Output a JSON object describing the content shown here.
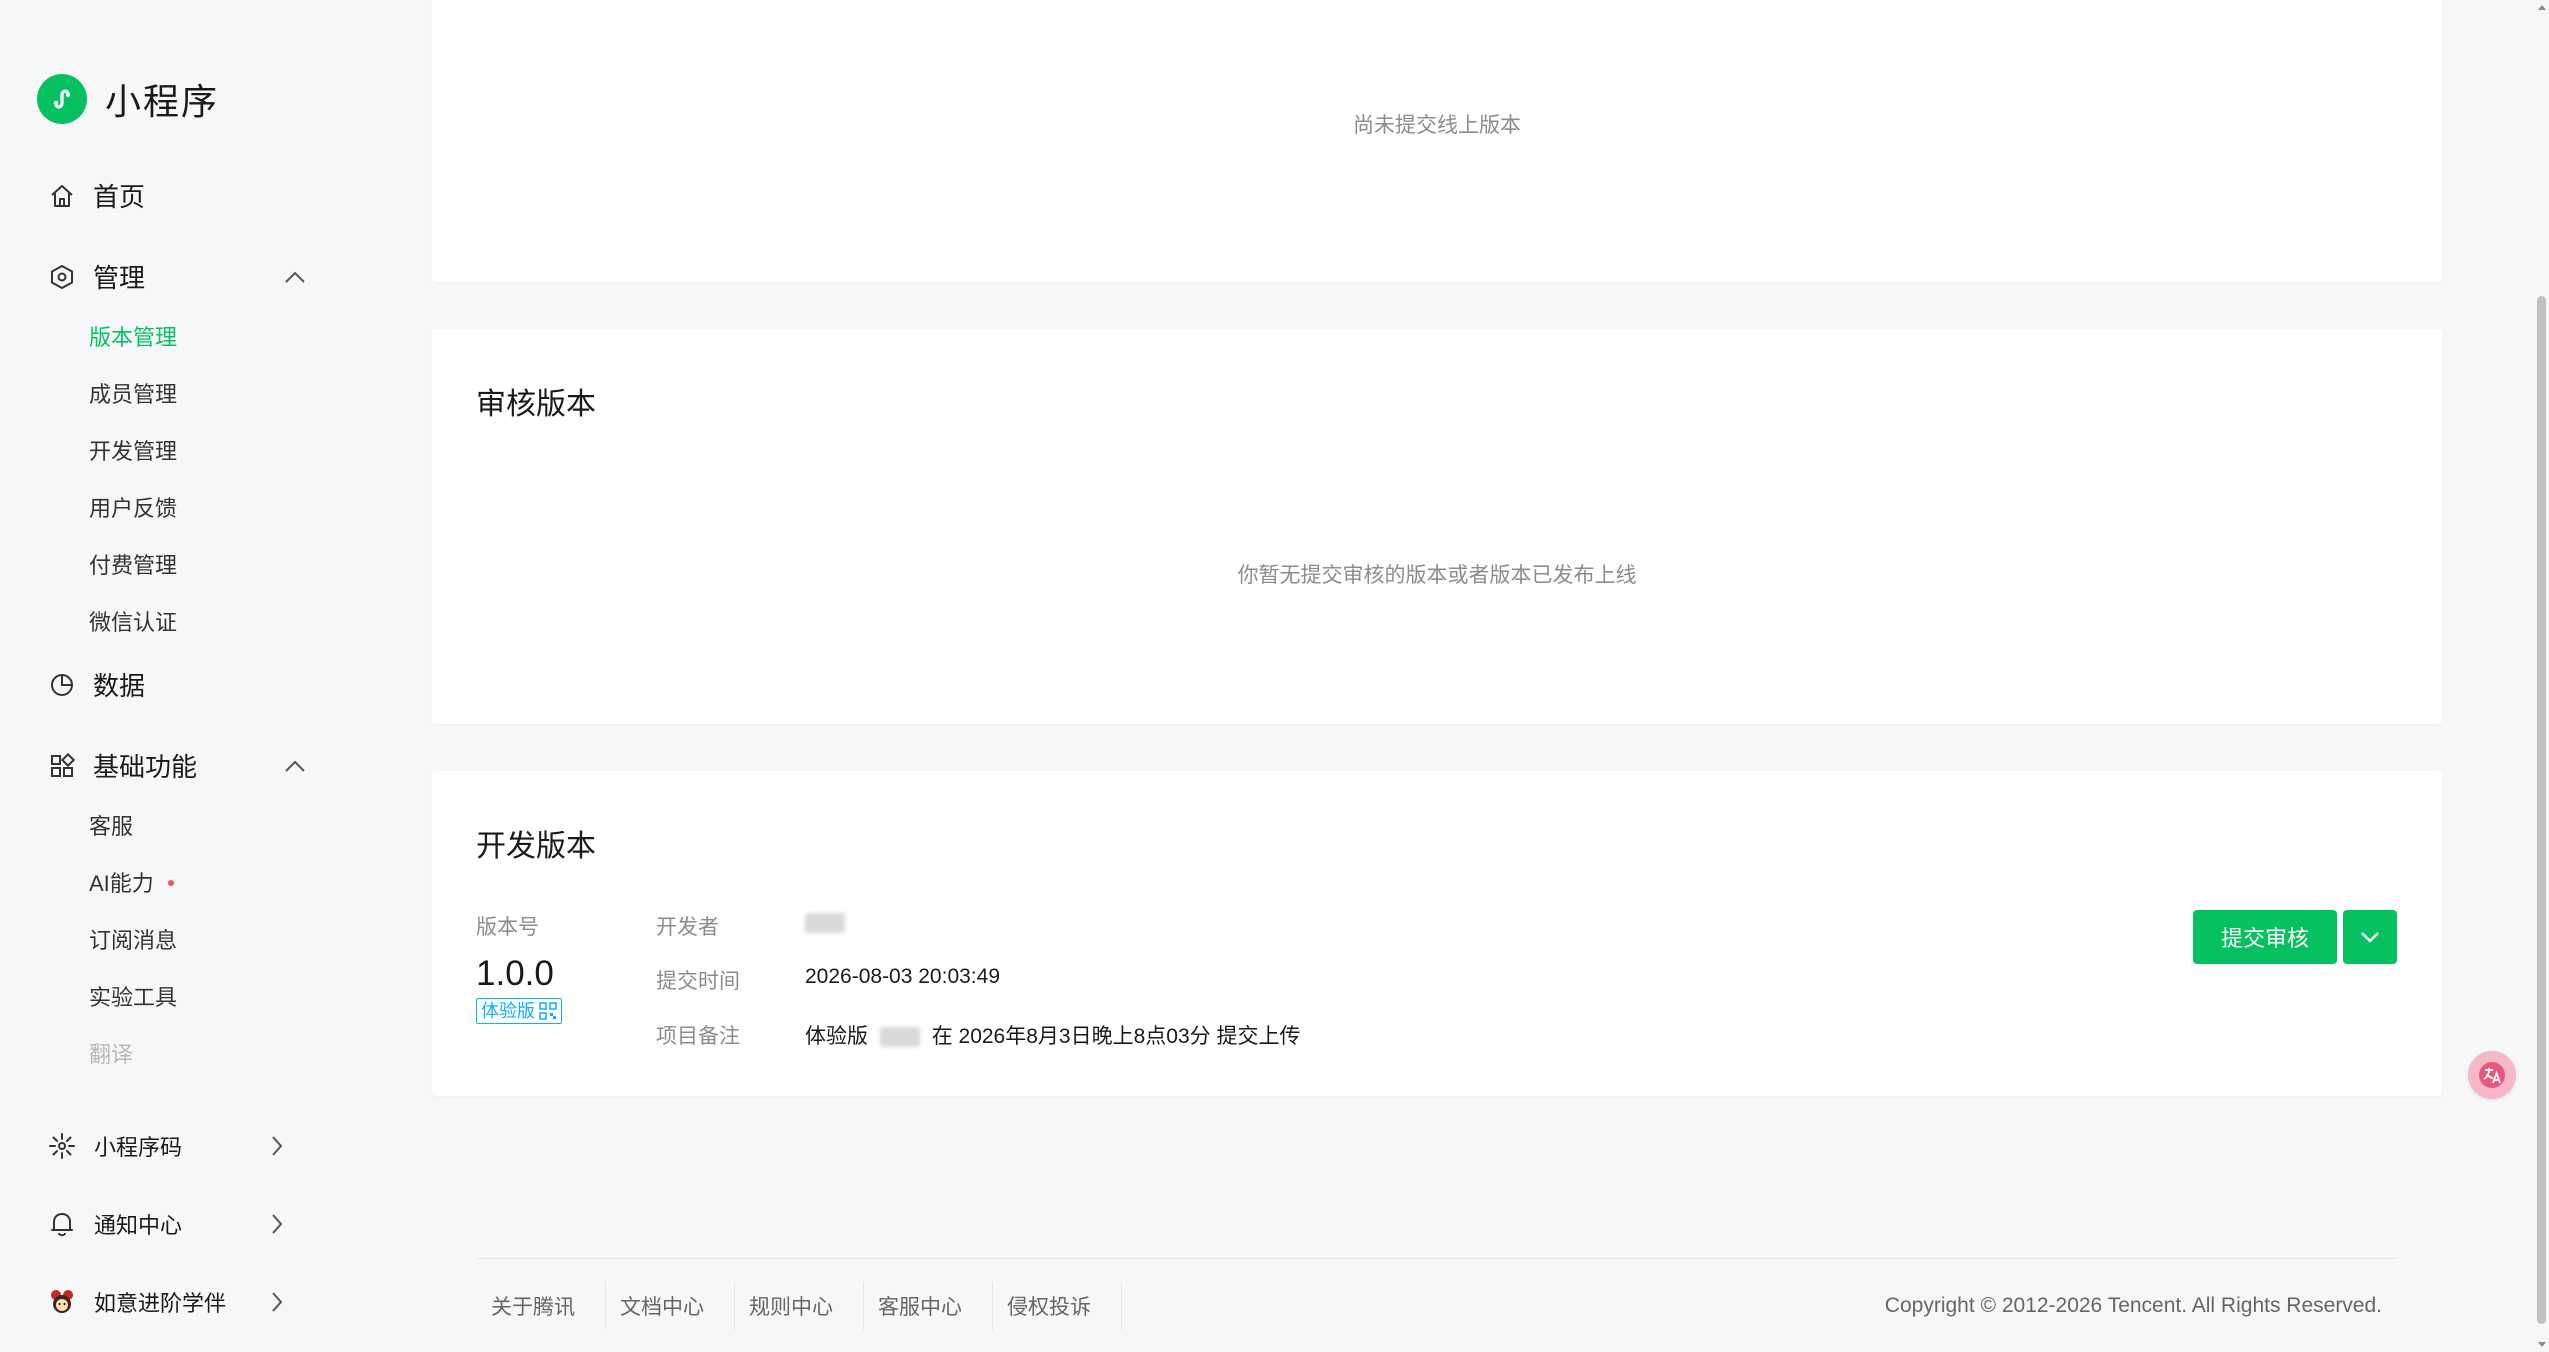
{
  "brand": {
    "name": "小程序",
    "accent": "#07c160"
  },
  "nav": {
    "home": {
      "label": "首页",
      "icon": "home-icon"
    },
    "manage": {
      "label": "管理",
      "icon": "settings-hexagon-icon",
      "items": [
        {
          "label": "版本管理",
          "active": true
        },
        {
          "label": "成员管理"
        },
        {
          "label": "开发管理"
        },
        {
          "label": "用户反馈"
        },
        {
          "label": "付费管理"
        },
        {
          "label": "微信认证"
        }
      ]
    },
    "data": {
      "label": "数据",
      "icon": "pie-chart-icon"
    },
    "basic": {
      "label": "基础功能",
      "icon": "grid-apps-icon",
      "items": [
        {
          "label": "客服"
        },
        {
          "label": "AI能力",
          "badge_dot": true
        },
        {
          "label": "订阅消息"
        },
        {
          "label": "实验工具"
        },
        {
          "label": "翻译",
          "disabled": true
        }
      ]
    },
    "bottom": [
      {
        "label": "小程序码",
        "icon": "miniprogram-code-icon"
      },
      {
        "label": "通知中心",
        "icon": "bell-icon"
      },
      {
        "label": "如意进阶学伴",
        "icon": "avatar-icon"
      }
    ]
  },
  "online_card": {
    "empty_text": "尚未提交线上版本"
  },
  "review_card": {
    "title": "审核版本",
    "empty_text": "你暂无提交审核的版本或者版本已发布上线"
  },
  "dev_card": {
    "title": "开发版本",
    "version_label": "版本号",
    "version": "1.0.0",
    "trial_tag": "体验版",
    "developer_label": "开发者",
    "submit_time_label": "提交时间",
    "submit_time": "2026-08-03 20:03:49",
    "note_label": "项目备注",
    "note_prefix": "体验版",
    "note_suffix": "在 2026年8月3日晚上8点03分 提交上传",
    "submit_button": "提交审核"
  },
  "footer": {
    "links": [
      "关于腾讯",
      "文档中心",
      "规则中心",
      "客服中心",
      "侵权投诉"
    ],
    "copyright": "Copyright © 2012-2026 Tencent. All Rights Reserved."
  }
}
